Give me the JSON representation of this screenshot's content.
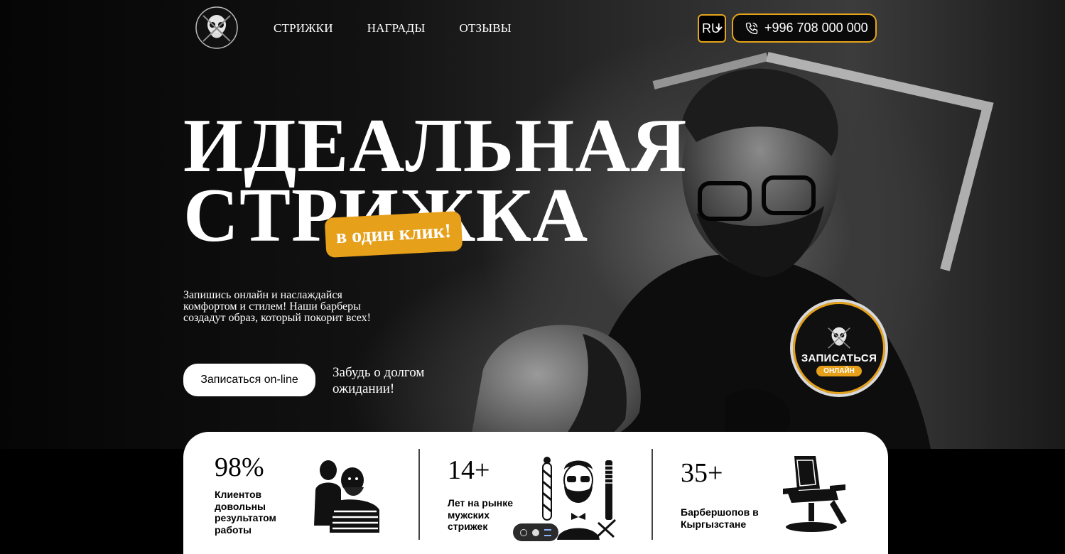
{
  "header": {
    "nav": [
      "СТРИЖКИ",
      "НАГРАДЫ",
      "ОТЗЫВЫ"
    ],
    "language": "RU",
    "phone": "+996 708 000 000"
  },
  "hero": {
    "title_line1": "ИДЕАЛЬНАЯ",
    "title_line2": "СТРИЖКА",
    "sticker": "в один клик!",
    "subtitle": "Запишись онлайн и наслаждайся комфортом и стилем! Наши барберы создадут образ, который покорит всех!",
    "cta": "Записаться on-line",
    "tagline": "Забудь о долгом ожидании!",
    "badge_top": "ЗАПИСАТЬСЯ",
    "badge_bottom": "ОНЛАЙН"
  },
  "stats": [
    {
      "value": "98%",
      "label": "Клиентов довольны результатом работы",
      "icon": "barber-client-icon"
    },
    {
      "value": "14+",
      "label": "Лет на рынке мужских стрижек",
      "icon": "bearded-man-icon"
    },
    {
      "value": "35+",
      "label": "Барбершопов в Кыргызстане",
      "icon": "barber-chair-icon"
    }
  ],
  "colors": {
    "accent": "#e6a01a",
    "background": "#000000",
    "card": "#ffffff"
  }
}
